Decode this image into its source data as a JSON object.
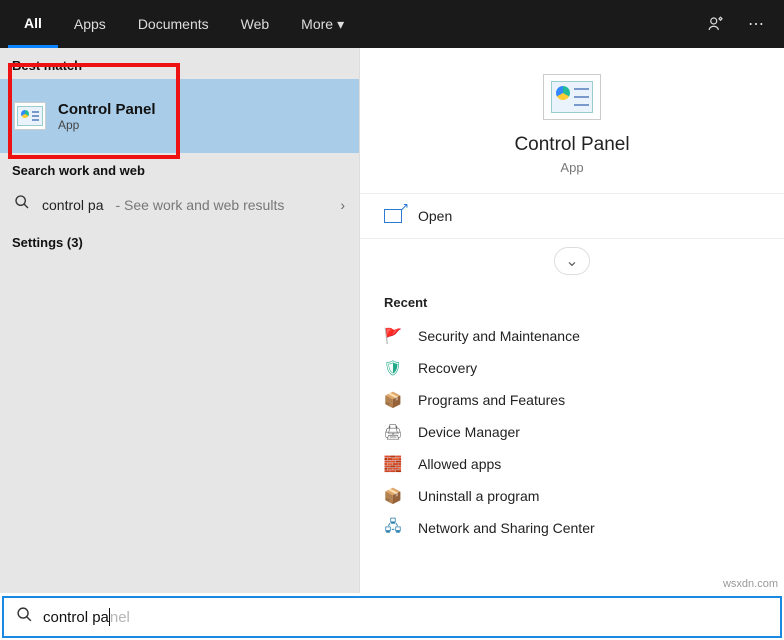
{
  "topbar": {
    "tabs": {
      "all": "All",
      "apps": "Apps",
      "documents": "Documents",
      "web": "Web",
      "more": "More"
    }
  },
  "left": {
    "best_match_header": "Best match",
    "best_match": {
      "title": "Control Panel",
      "subtitle": "App"
    },
    "search_web_header": "Search work and web",
    "search_row": {
      "query": "control pa",
      "hint": " - See work and web results"
    },
    "settings_header": "Settings  (3)"
  },
  "preview": {
    "title": "Control Panel",
    "subtitle": "App",
    "open_label": "Open",
    "recent_header": "Recent",
    "recent": [
      {
        "label": "Security and Maintenance",
        "icon": "🚩",
        "color": "#2a7ad4"
      },
      {
        "label": "Recovery",
        "icon": "🛡",
        "color": "#2a8"
      },
      {
        "label": "Programs and Features",
        "icon": "📦",
        "color": "#888"
      },
      {
        "label": "Device Manager",
        "icon": "🖨",
        "color": "#666"
      },
      {
        "label": "Allowed apps",
        "icon": "🧱",
        "color": "#c44"
      },
      {
        "label": "Uninstall a program",
        "icon": "📦",
        "color": "#888"
      },
      {
        "label": "Network and Sharing Center",
        "icon": "🖧",
        "color": "#27a"
      }
    ]
  },
  "searchbar": {
    "typed": "control pa",
    "ghost": "nel"
  },
  "watermark": "wsxdn.com"
}
